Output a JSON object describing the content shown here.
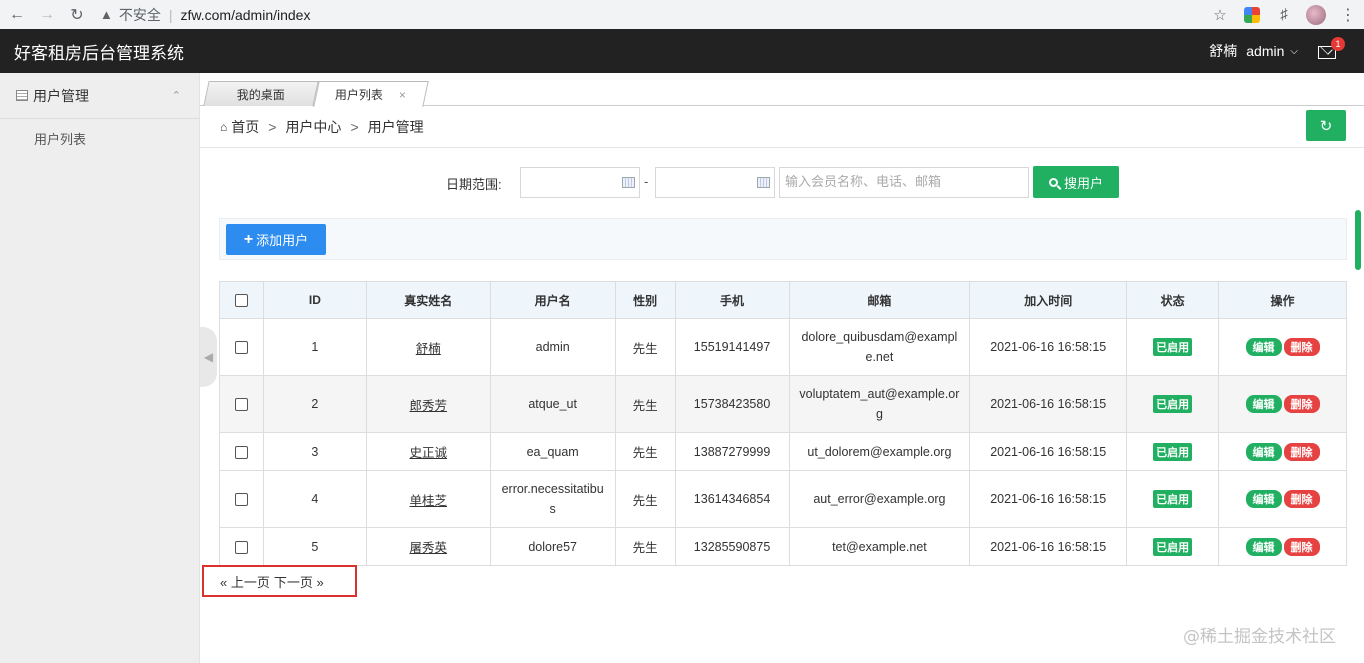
{
  "browser": {
    "security": "不安全",
    "url": "zfw.com/admin/index"
  },
  "header": {
    "title": "好客租房后台管理系统",
    "user_name": "舒楠",
    "user_role": "admin",
    "mail_badge": "1"
  },
  "sidebar": {
    "group_label": "用户管理",
    "items": [
      {
        "label": "用户列表"
      }
    ]
  },
  "tabs": [
    {
      "label": "我的桌面"
    },
    {
      "label": "用户列表",
      "close": "×"
    }
  ],
  "breadcrumb": [
    "首页",
    "用户中心",
    "用户管理"
  ],
  "breadcrumb_sep": ">",
  "search": {
    "date_label": "日期范围:",
    "range_sep": "-",
    "keyword_placeholder": "输入会员名称、电话、邮箱",
    "button_label": "搜用户"
  },
  "toolbar": {
    "add_label": "添加用户"
  },
  "table": {
    "columns": [
      "ID",
      "真实姓名",
      "用户名",
      "性别",
      "手机",
      "邮箱",
      "加入时间",
      "状态",
      "操作"
    ],
    "rows": [
      {
        "id": "1",
        "name": "舒楠",
        "username": "admin",
        "gender": "先生",
        "phone": "15519141497",
        "email": "dolore_quibusdam@example.net",
        "joined": "2021-06-16 16:58:15",
        "status": "已启用"
      },
      {
        "id": "2",
        "name": "郎秀芳",
        "username": "atque_ut",
        "gender": "先生",
        "phone": "15738423580",
        "email": "voluptatem_aut@example.org",
        "joined": "2021-06-16 16:58:15",
        "status": "已启用"
      },
      {
        "id": "3",
        "name": "史正诚",
        "username": "ea_quam",
        "gender": "先生",
        "phone": "13887279999",
        "email": "ut_dolorem@example.org",
        "joined": "2021-06-16 16:58:15",
        "status": "已启用"
      },
      {
        "id": "4",
        "name": "单桂芝",
        "username": "error.necessitatibus",
        "gender": "先生",
        "phone": "13614346854",
        "email": "aut_error@example.org",
        "joined": "2021-06-16 16:58:15",
        "status": "已启用"
      },
      {
        "id": "5",
        "name": "屠秀英",
        "username": "dolore57",
        "gender": "先生",
        "phone": "13285590875",
        "email": "tet@example.net",
        "joined": "2021-06-16 16:58:15",
        "status": "已启用"
      }
    ],
    "edit_label": "编辑",
    "delete_label": "删除"
  },
  "pager": {
    "prev": "« 上一页",
    "next": "下一页 »"
  },
  "watermark": "@稀土掘金技术社区",
  "colors": {
    "primary_green": "#21b062",
    "danger_red": "#e64242",
    "add_blue": "#2d8cf0",
    "header_bg": "#222222"
  }
}
